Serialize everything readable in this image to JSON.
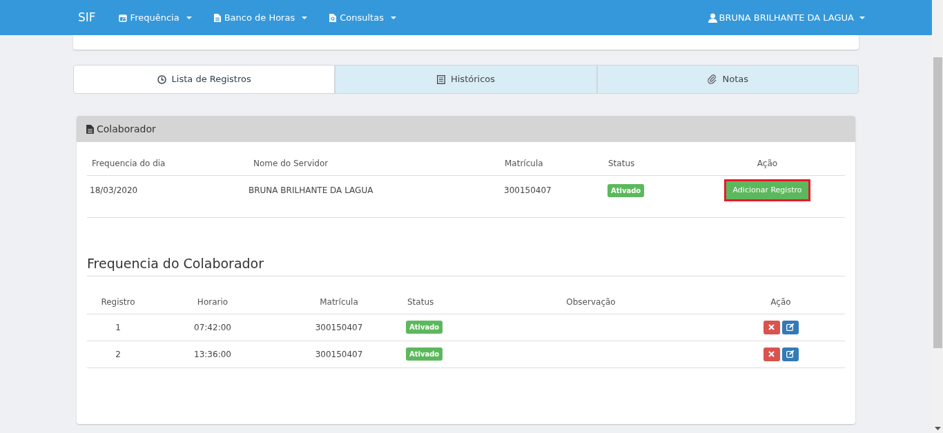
{
  "navbar": {
    "brand": "SIF",
    "menus": [
      {
        "label": "Frequência",
        "kind": "calendar"
      },
      {
        "label": "Banco de Horas",
        "kind": "document"
      },
      {
        "label": "Consultas",
        "kind": "search-document"
      }
    ],
    "user": "BRUNA BRILHANTE DA LAGUA"
  },
  "tabs": [
    {
      "label": "Lista de Registros",
      "kind": "clock",
      "selected": true
    },
    {
      "label": "Históricos",
      "kind": "list",
      "selected": false
    },
    {
      "label": "Notas",
      "kind": "paperclip",
      "selected": false
    }
  ],
  "panel": {
    "title": "Colaborador",
    "table": {
      "columns": [
        "Frequencia do dia",
        "Nome do Servidor",
        "Matrícula",
        "Status",
        "Ação"
      ],
      "rows": [
        {
          "date": "18/03/2020",
          "name": "BRUNA BRILHANTE DA LAGUA",
          "matricula": "300150407",
          "status": "Ativado",
          "action": "Adicionar Registro",
          "highlighted": true
        }
      ]
    },
    "section_title": "Frequencia do Colaborador",
    "records": {
      "columns": [
        "Registro",
        "Horario",
        "Matrícula",
        "Status",
        "Observação",
        "Ação"
      ],
      "rows": [
        {
          "registro": "1",
          "horario": "07:42:00",
          "matricula": "300150407",
          "status": "Ativado"
        },
        {
          "registro": "2",
          "horario": "13:36:00",
          "matricula": "300150407",
          "status": "Ativado"
        }
      ]
    }
  }
}
